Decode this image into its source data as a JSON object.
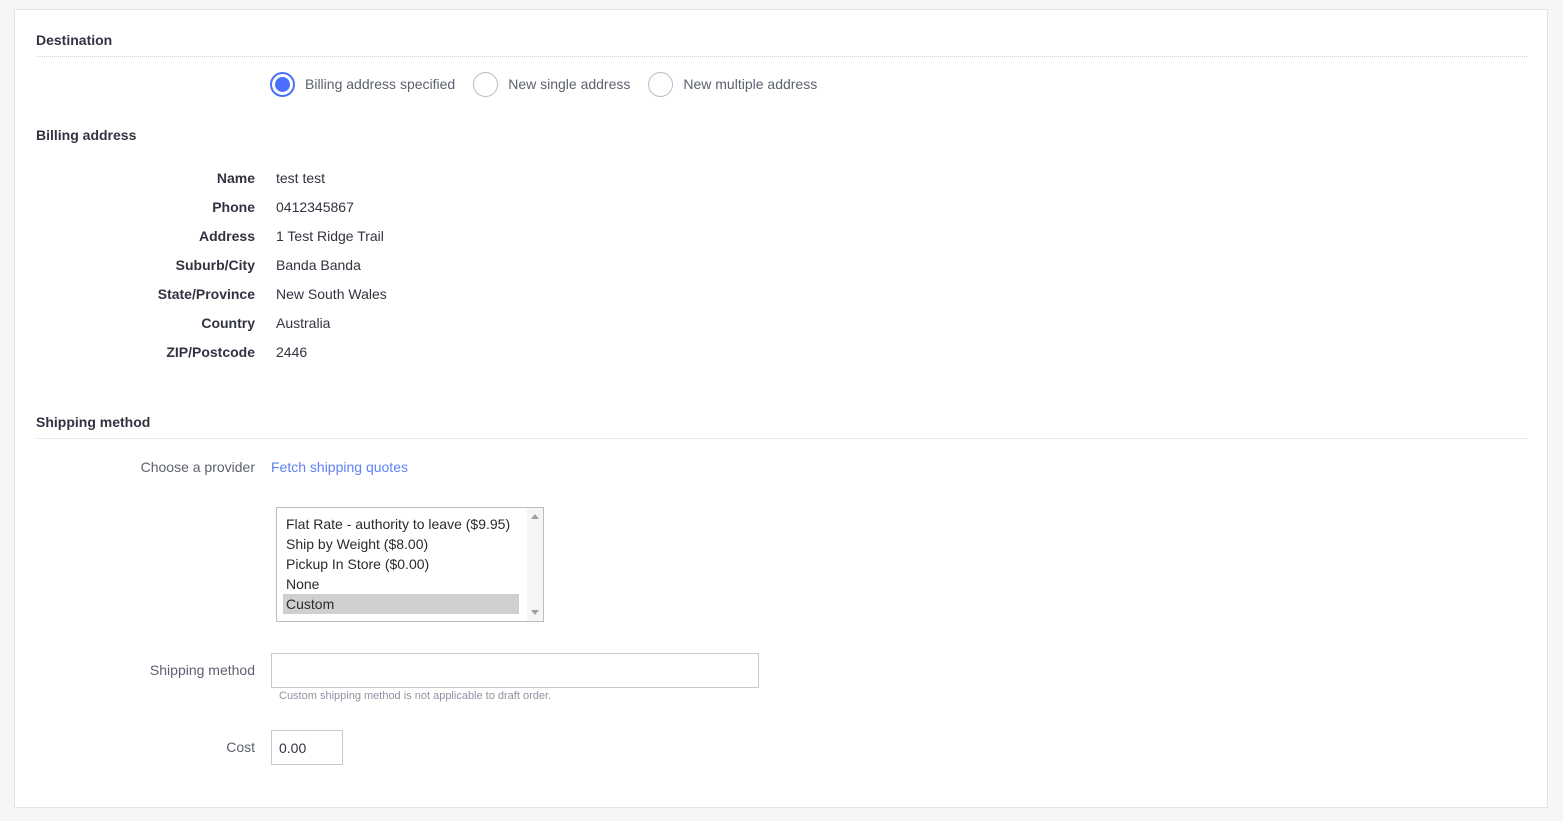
{
  "destination": {
    "title": "Destination",
    "options": [
      {
        "label": "Billing address specified",
        "checked": true
      },
      {
        "label": "New single address",
        "checked": false
      },
      {
        "label": "New multiple address",
        "checked": false
      }
    ]
  },
  "billing": {
    "title": "Billing address",
    "rows": [
      {
        "label": "Name",
        "value": "test test"
      },
      {
        "label": "Phone",
        "value": "0412345867"
      },
      {
        "label": "Address",
        "value": "1 Test Ridge Trail"
      },
      {
        "label": "Suburb/City",
        "value": "Banda Banda"
      },
      {
        "label": "State/Province",
        "value": "New South Wales"
      },
      {
        "label": "Country",
        "value": "Australia"
      },
      {
        "label": "ZIP/Postcode",
        "value": "2446"
      }
    ]
  },
  "shipping": {
    "title": "Shipping method",
    "provider_label": "Choose a provider",
    "fetch_link": "Fetch shipping quotes",
    "provider_options": [
      "Flat Rate - authority to leave ($9.95)",
      "Ship by Weight ($8.00)",
      "Pickup In Store ($0.00)",
      "None",
      "Custom"
    ],
    "selected_option": "Custom",
    "method_label": "Shipping method",
    "method_value": "",
    "method_help": "Custom shipping method is not applicable to draft order.",
    "cost_label": "Cost",
    "cost_value": "0.00"
  },
  "colors": {
    "accent": "#4b71fc",
    "link": "#5f81f5"
  }
}
